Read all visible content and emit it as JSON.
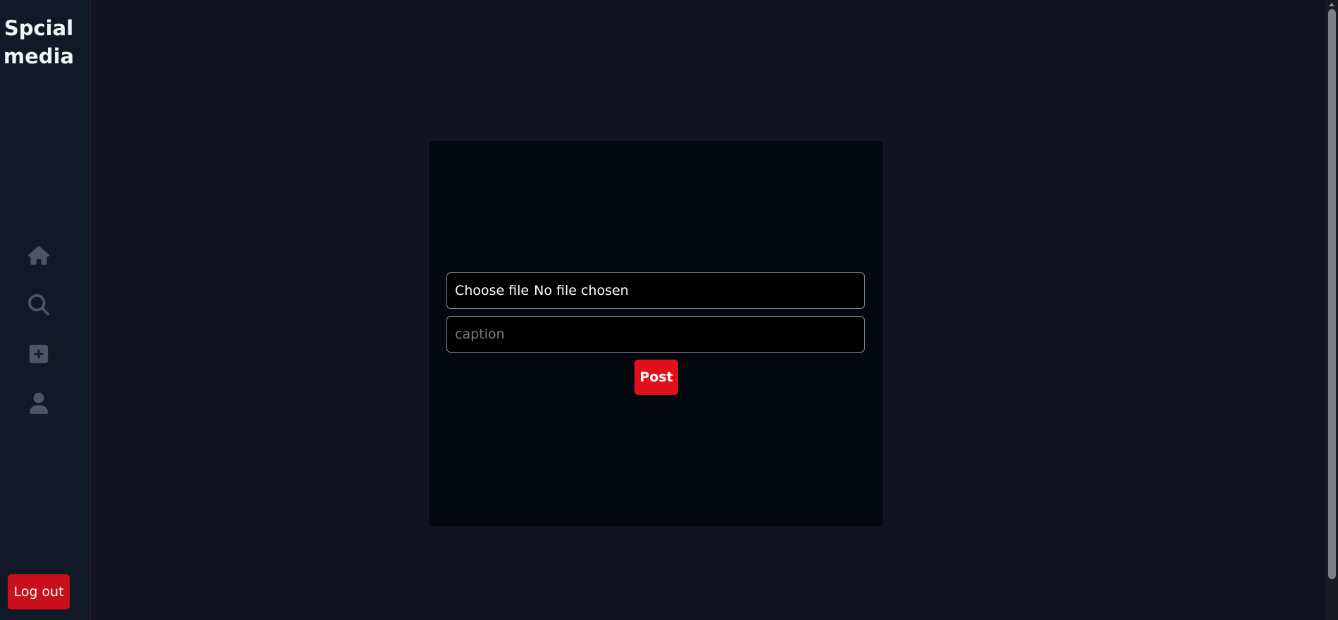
{
  "sidebar": {
    "brand": "Spcial media",
    "nav": [
      {
        "name": "home",
        "icon": "home-icon"
      },
      {
        "name": "search",
        "icon": "search-icon"
      },
      {
        "name": "create",
        "icon": "plus-square-icon"
      },
      {
        "name": "profile",
        "icon": "user-icon"
      }
    ],
    "logout_label": "Log out"
  },
  "form": {
    "file_button_label": "Choose file",
    "file_status": "No file chosen",
    "caption_placeholder": "caption",
    "caption_value": "",
    "post_label": "Post"
  },
  "colors": {
    "page_bg": "#121222",
    "sidebar_bg": "#111827",
    "card_bg": "#030810",
    "accent_red": "#e3101c",
    "icon_gray": "#4b5566"
  }
}
